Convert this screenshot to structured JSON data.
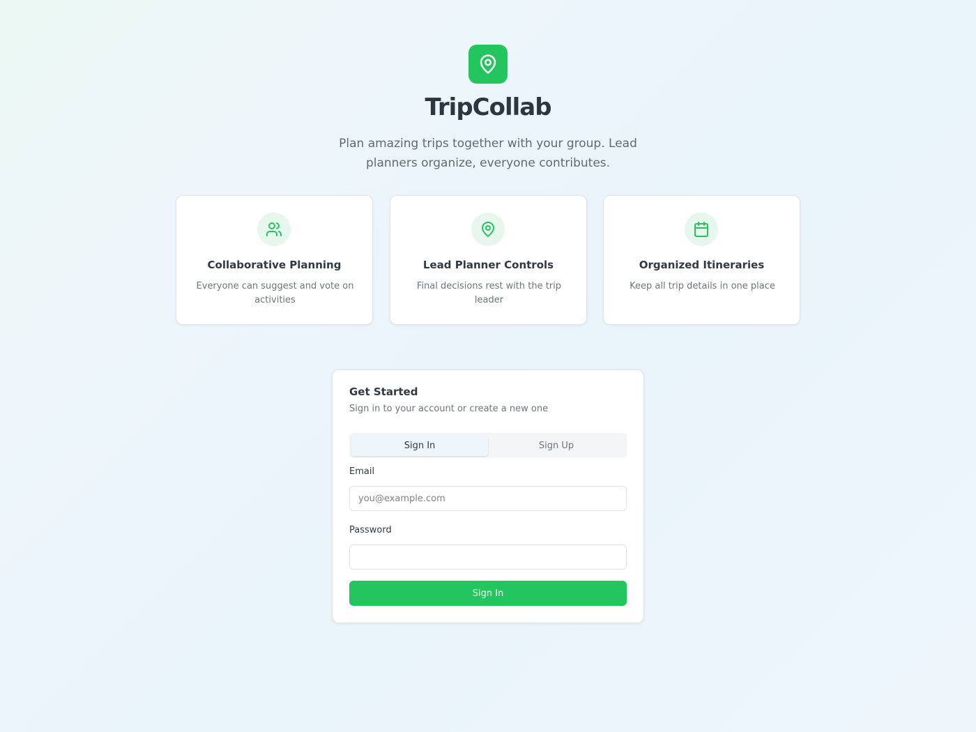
{
  "brand": {
    "name": "TripCollab",
    "tagline": "Plan amazing trips together with your group. Lead planners organize, everyone contributes.",
    "logo_icon": "map-pin-icon",
    "accent_color": "#22c55e"
  },
  "features": [
    {
      "icon": "users-icon",
      "title": "Collaborative Planning",
      "description": "Everyone can suggest and vote on activities"
    },
    {
      "icon": "map-pin-icon",
      "title": "Lead Planner Controls",
      "description": "Final decisions rest with the trip leader"
    },
    {
      "icon": "calendar-icon",
      "title": "Organized Itineraries",
      "description": "Keep all trip details in one place"
    }
  ],
  "auth": {
    "title": "Get Started",
    "subtitle": "Sign in to your account or create a new one",
    "tabs": [
      {
        "label": "Sign In",
        "active": true
      },
      {
        "label": "Sign Up",
        "active": false
      }
    ],
    "email_label": "Email",
    "email_placeholder": "you@example.com",
    "email_value": "",
    "password_label": "Password",
    "password_value": "",
    "submit_label": "Sign In"
  }
}
